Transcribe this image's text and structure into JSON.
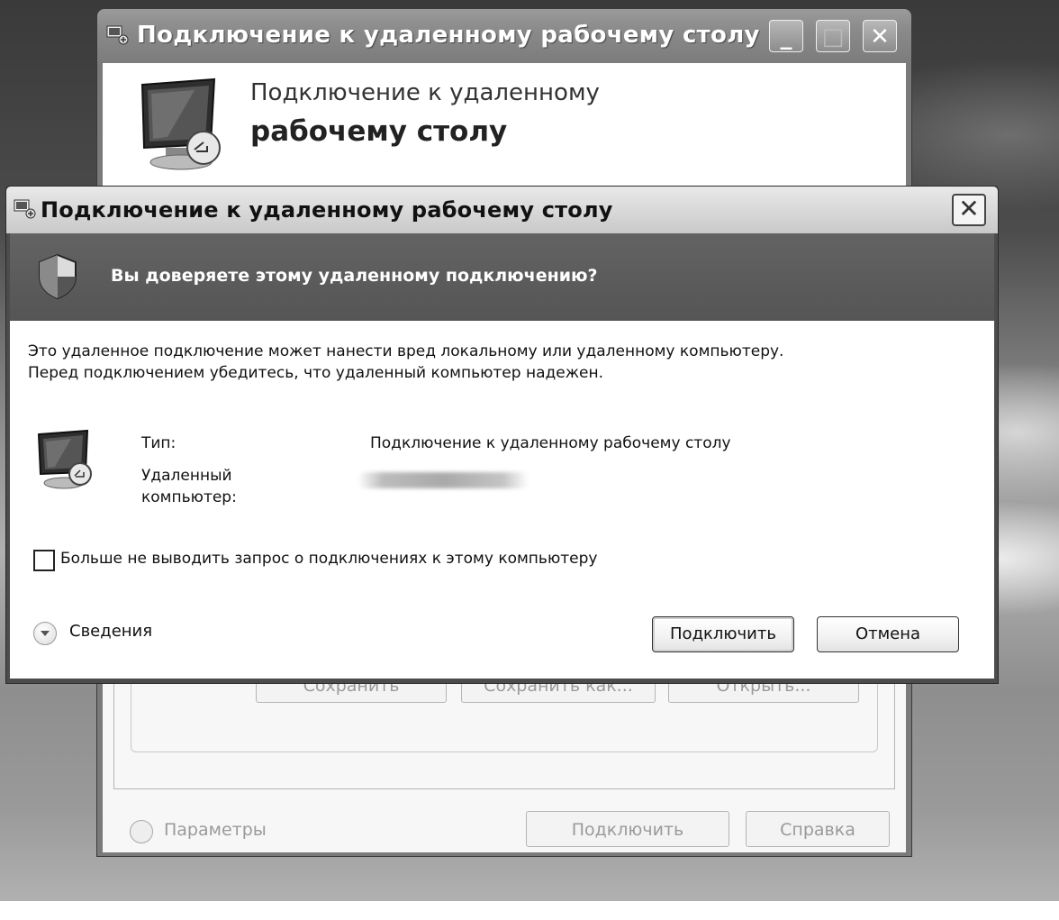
{
  "background_window": {
    "title": "Подключение к удаленному рабочему столу",
    "header_line1": "Подключение к удаленному",
    "header_line2": "рабочему столу",
    "minimize_glyph": "_",
    "maximize_glyph": "□",
    "close_glyph": "✕",
    "buttons": {
      "save": "Сохранить",
      "save_as": "Сохранить как...",
      "open": "Открыть...",
      "connect": "Подключить",
      "help": "Справка"
    },
    "params_label": "Параметры"
  },
  "dialog": {
    "title": "Подключение к удаленному рабочему столу",
    "close_glyph": "✕",
    "banner_question": "Вы доверяете этому удаленному подключению?",
    "warning_line1": "Это удаленное подключение может нанести вред локальному или удаленному компьютеру.",
    "warning_line2": "Перед подключением убедитесь, что удаленный компьютер надежен.",
    "type_label": "Тип:",
    "type_value": "Подключение к удаленному рабочему столу",
    "remote_label_line1": "Удаленный",
    "remote_label_line2": "компьютер:",
    "checkbox_label": "Больше не выводить запрос о подключениях к этому компьютеру",
    "checkbox_checked": false,
    "details_label": "Сведения",
    "connect_button": "Подключить",
    "cancel_button": "Отмена"
  },
  "icons": {
    "window": "rdp-window-icon",
    "shield": "shield-icon",
    "monitor": "monitor-icon",
    "expand": "chevron-down-icon",
    "collapse": "chevron-up-icon"
  },
  "colors": {
    "banner": "#5a5a5a",
    "dialog_body": "#ffffff",
    "title_bar": "#d9d9d9"
  }
}
